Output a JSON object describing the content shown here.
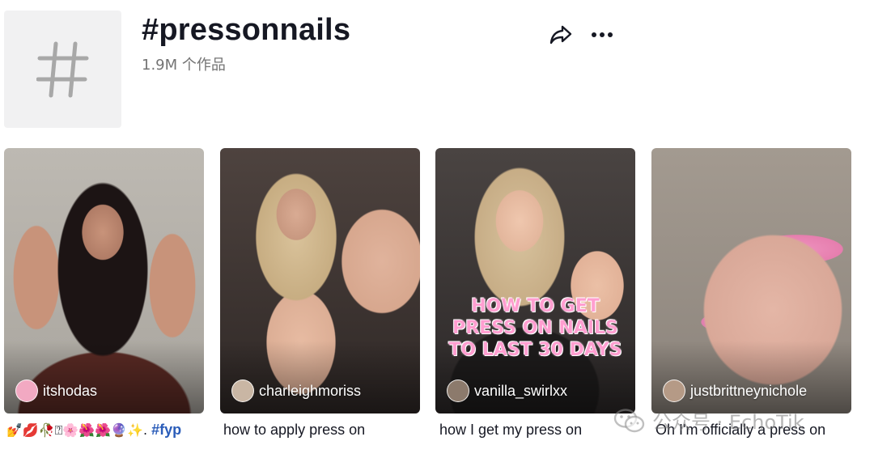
{
  "header": {
    "title": "#pressonnails",
    "count": "1.9M 个作品",
    "tag_symbol": "#",
    "share_icon": "share-arrow-icon",
    "more_icon": "more-horizontal-icon"
  },
  "videos": [
    {
      "username": "itshodas",
      "caption_emoji": "💅💋🥀⍰🌸🌺🌺🔮✨.",
      "caption_hashtag": "#fyp",
      "bg_colors": [
        "#b3afa8",
        "#7a5a4a",
        "#5a2a24"
      ]
    },
    {
      "username": "charleighmoriss",
      "caption": "how to apply press on",
      "bg_colors": [
        "#5a4a45",
        "#3a302c",
        "#c9a08a"
      ]
    },
    {
      "username": "vanilla_swirlxx",
      "caption": "how I get my press on",
      "overlay_text": "HOW TO GET PRESS ON NAILS TO LAST 30 DAYS",
      "bg_colors": [
        "#4a4442",
        "#2a2626",
        "#e2b39a"
      ]
    },
    {
      "username": "justbrittneynichole",
      "caption": "Oh I'm officially a press on",
      "bg_colors": [
        "#9c948c",
        "#e0b7a8",
        "#e98fb8"
      ]
    }
  ],
  "watermark": {
    "text": "公众号 · EchoTik",
    "icon": "wechat-icon"
  },
  "colors": {
    "hashtag": "#2b5db9",
    "text_primary": "#161823",
    "text_secondary": "#737373",
    "overlay_pink": "#ff9ed0"
  }
}
